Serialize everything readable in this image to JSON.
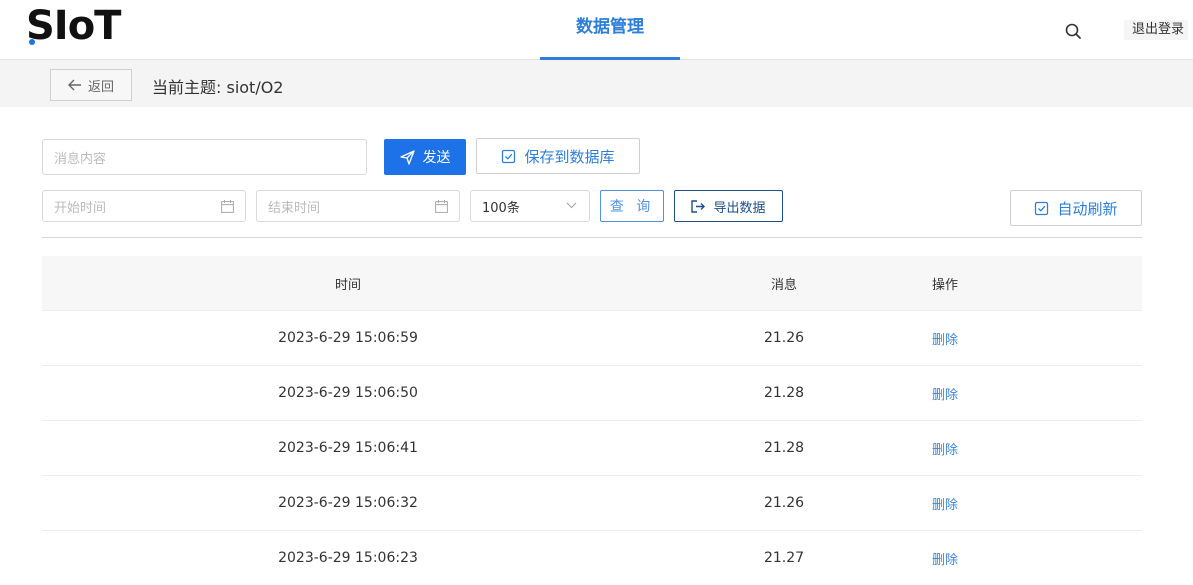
{
  "header": {
    "logo": "SIoT",
    "nav_tab": "数据管理",
    "logout": "退出登录"
  },
  "subbar": {
    "back_label": "返回",
    "topic": "当前主题: siot/O2"
  },
  "form": {
    "message_placeholder": "消息内容",
    "send_label": "发送",
    "save_label": "保存到数据库",
    "start_placeholder": "开始时间",
    "end_placeholder": "结束时间",
    "count_value": "100条",
    "query_label": "查 询",
    "export_label": "导出数据",
    "auto_refresh_label": "自动刷新"
  },
  "table": {
    "headers": {
      "time": "时间",
      "message": "消息",
      "action": "操作"
    },
    "delete_label": "删除",
    "rows": [
      {
        "time": "2023-6-29 15:06:59",
        "message": "21.26"
      },
      {
        "time": "2023-6-29 15:06:50",
        "message": "21.28"
      },
      {
        "time": "2023-6-29 15:06:41",
        "message": "21.28"
      },
      {
        "time": "2023-6-29 15:06:32",
        "message": "21.26"
      },
      {
        "time": "2023-6-29 15:06:23",
        "message": "21.27"
      }
    ]
  },
  "colors": {
    "accent": "#1e72e8",
    "link": "#3b86d6",
    "nav_active": "#2e7fd9"
  },
  "icons": [
    "search-icon",
    "arrow-left-icon",
    "send-icon",
    "checkbox-icon",
    "calendar-icon",
    "chevron-down-icon",
    "export-icon"
  ]
}
